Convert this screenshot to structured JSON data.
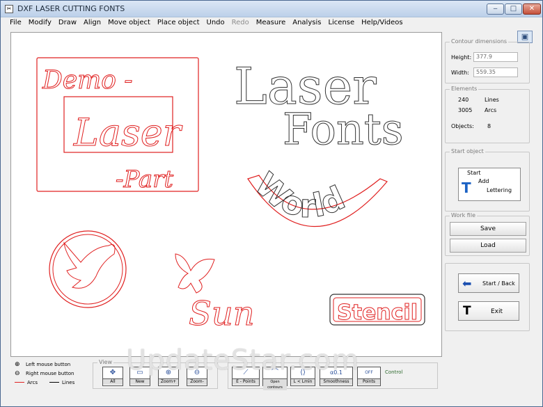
{
  "window": {
    "title": "DXF LASER CUTTING FONTS",
    "icon": "cnc-app-icon",
    "controls": [
      "minimize-icon",
      "maximize-icon",
      "close-icon"
    ]
  },
  "menu": [
    "File",
    "Modify",
    "Draw",
    "Align",
    "Move object",
    "Place object",
    "Undo",
    "Redo",
    "Measure",
    "Analysis",
    "License",
    "Help/Videos"
  ],
  "menu_disabled": [
    "Redo"
  ],
  "canvas": {
    "texts": {
      "demo": "Demo -",
      "laser_script": "Laser",
      "part": "-Part",
      "laser_outline": "Laser",
      "fonts": "Fonts",
      "world": "World",
      "sun": "Sun",
      "stencil": "Stencil"
    },
    "colors": {
      "contour": "#e02020",
      "outline": "#333333"
    }
  },
  "panel": {
    "contour": {
      "label": "Contour dimensions",
      "height_label": "Height:",
      "height_value": "377.9",
      "width_label": "Width:",
      "width_value": "559.35"
    },
    "elements": {
      "label": "Elements",
      "lines_count": "240",
      "lines_label": "Lines",
      "arcs_count": "3005",
      "arcs_label": "Arcs",
      "objects_label": "Objects:",
      "objects_value": "8"
    },
    "start_object": {
      "label": "Start object",
      "start": "Start",
      "add": "Add",
      "lettering": "Lettering"
    },
    "work_file": {
      "label": "Work file",
      "save": "Save",
      "load": "Load"
    },
    "nav": {
      "start_back": "Start / Back",
      "exit": "Exit"
    }
  },
  "bottom": {
    "legend": {
      "left_mouse": "Left mouse button",
      "right_mouse": "Right mouse button",
      "arcs": "Arcs",
      "lines": "Lines",
      "arcs_color": "#e02020",
      "lines_color": "#000000"
    },
    "view_label": "View",
    "view_buttons": [
      "All",
      "New",
      "Zoom+",
      "Zoom-"
    ],
    "tools": [
      "E - Points",
      "Open contours",
      "L < Lmin",
      "Smoothness",
      "Points"
    ],
    "smooth_value": "0.1",
    "control_label": "Control"
  },
  "watermark": "UpdateStar.com"
}
